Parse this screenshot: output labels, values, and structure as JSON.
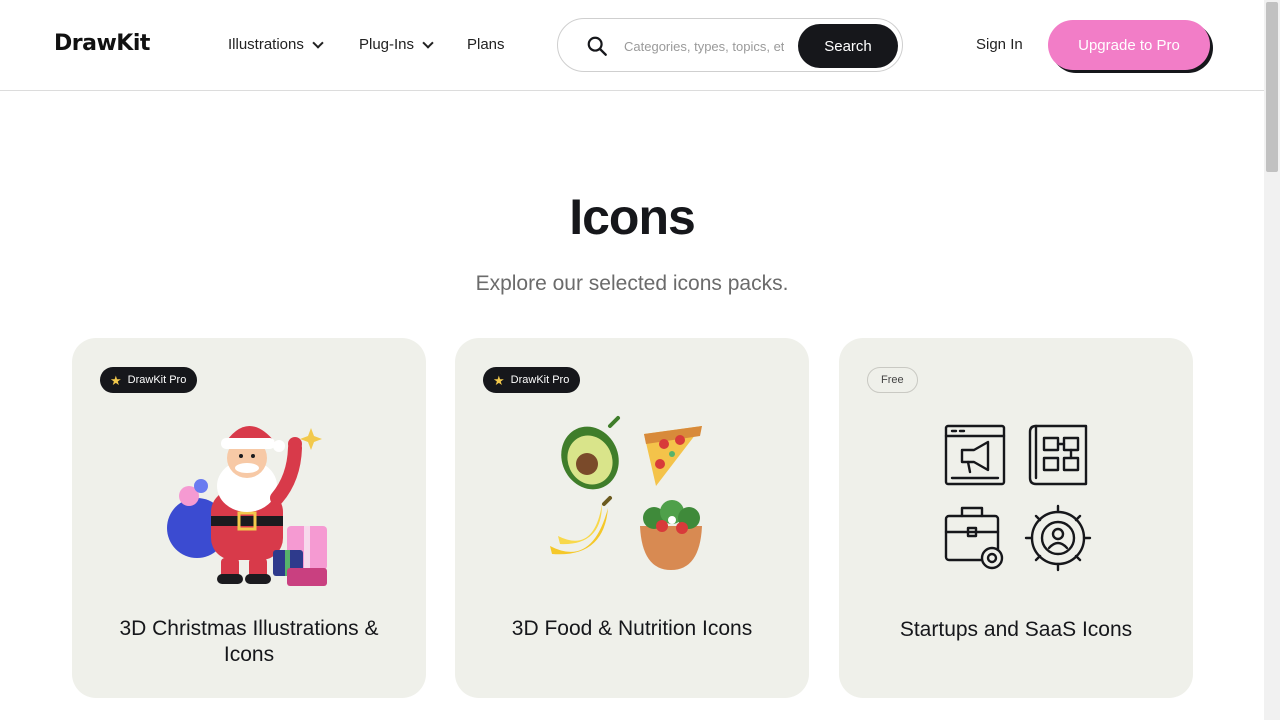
{
  "header": {
    "logo": "DrawKit",
    "nav": [
      {
        "label": "Illustrations",
        "has_dropdown": true
      },
      {
        "label": "Plug-Ins",
        "has_dropdown": true
      },
      {
        "label": "Plans",
        "has_dropdown": false
      }
    ],
    "search": {
      "placeholder": "Categories, types, topics, etc",
      "value": "",
      "button_label": "Search",
      "icon": "search-icon"
    },
    "sign_in": "Sign In",
    "upgrade": "Upgrade to Pro"
  },
  "hero": {
    "title": "Icons",
    "subtitle": "Explore our selected icons packs."
  },
  "cards": [
    {
      "badge": "DrawKit Pro",
      "badge_type": "pro",
      "title": "3D Christmas Illustrations & Icons",
      "art": "santa-illustration"
    },
    {
      "badge": "DrawKit Pro",
      "badge_type": "pro",
      "title": "3D Food & Nutrition Icons",
      "art": "food-icons"
    },
    {
      "badge": "Free",
      "badge_type": "free",
      "title": "Startups and SaaS Icons",
      "art": "startup-icons"
    }
  ],
  "colors": {
    "accent": "#f27dc7",
    "dark": "#16171b",
    "card_bg": "#eff0ea",
    "star": "#f2c94c"
  }
}
